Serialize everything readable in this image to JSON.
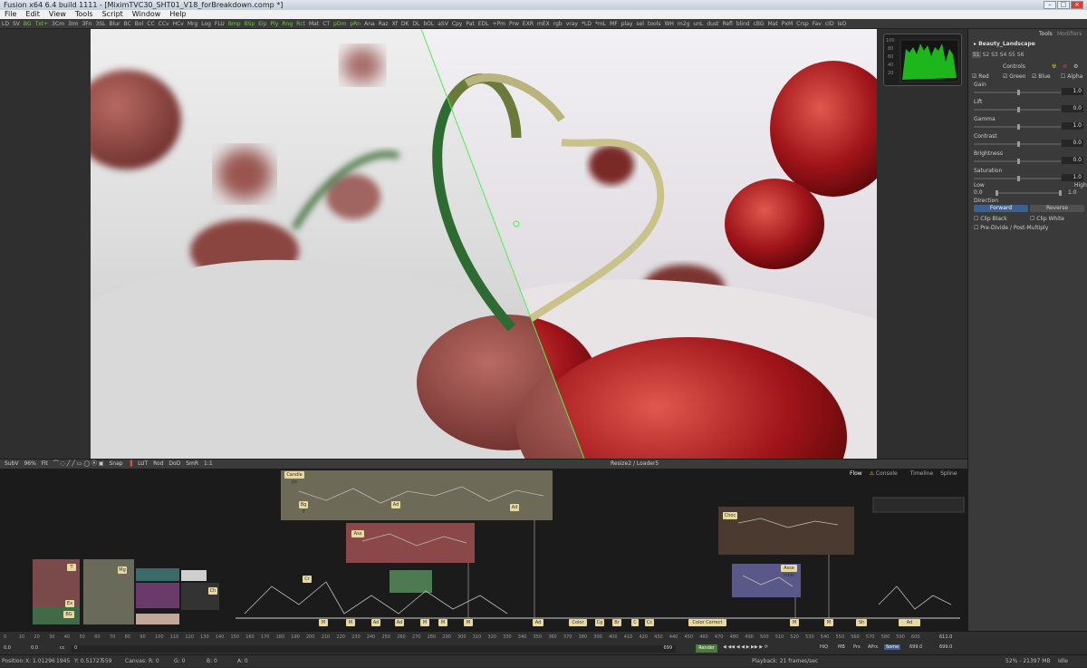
{
  "window": {
    "title": "Fusion x64 6.4 build 1111 - [MiximTVC30_SHT01_V18_forBreakdown.comp *]",
    "controls": [
      "–",
      "□",
      "×"
    ]
  },
  "menu": [
    "File",
    "Edit",
    "View",
    "Tools",
    "Script",
    "Window",
    "Help"
  ],
  "toolbar": [
    "LD",
    "SV",
    "BG",
    "Txt+",
    "3Cm",
    "3Im",
    "3Fn",
    "3SL",
    "Blur",
    "BC",
    "Bol",
    "CC",
    "CCv",
    "HCv",
    "Mrg",
    "Log",
    "FLU",
    "Bmp",
    "BSp",
    "Elp",
    "Ply",
    "Rng",
    "Rct",
    "Mat",
    "CT",
    "pDm",
    "pRn",
    "Ana",
    "Raz",
    "Xf",
    "DK",
    "DL",
    "bOL",
    "aSV",
    "Cpy",
    "Pat",
    "EDL",
    "+Pm",
    "Prw",
    "EXR",
    "mEX",
    "rgb",
    "vray",
    "*LD",
    "*mL",
    "MF",
    "play",
    "sel",
    "tools",
    "WH",
    "m2g",
    "unL",
    "dust",
    "Refl",
    "blind",
    "cBG",
    "Mat",
    "PxM",
    "Crsp",
    "Fav",
    "cID",
    "IsO"
  ],
  "viewer": {
    "buttons": [
      "SubV",
      "96%",
      "Fit",
      "Snap",
      "LUT",
      "Rod",
      "DoD",
      "SmR",
      "1:1"
    ],
    "title": "Resize2 / Loader5",
    "scope_ticks": [
      "100",
      "80",
      "60",
      "40",
      "20"
    ]
  },
  "inspector": {
    "tabs": [
      "Tools",
      "Modifiers"
    ],
    "tool_name": "Beauty_Landscape",
    "channel_tabs": [
      "S1",
      "S2",
      "S3",
      "S4",
      "S5",
      "S6"
    ],
    "section": "Controls",
    "channels": [
      {
        "label": "Red"
      },
      {
        "label": "Green"
      },
      {
        "label": "Blue"
      },
      {
        "label": "Alpha"
      }
    ],
    "params": [
      {
        "label": "Gain",
        "value": "1.0"
      },
      {
        "label": "Lift",
        "value": "0.0"
      },
      {
        "label": "Gamma",
        "value": "1.0"
      },
      {
        "label": "Contrast",
        "value": "0.0"
      },
      {
        "label": "Brightness",
        "value": "0.0"
      },
      {
        "label": "Saturation",
        "value": "1.0"
      }
    ],
    "low_label": "Low",
    "high_label": "High",
    "low_value": "0.0",
    "high_value": "1.0",
    "direction_label": "Direction",
    "forward": "Forward",
    "reverse": "Reverse",
    "clip_black": "Clip Black",
    "clip_white": "Clip White",
    "predivide": "Pre-Divide / Post-Multiply"
  },
  "flow": {
    "tabs": [
      "Flow",
      "Console",
      "Timeline",
      "Spline"
    ],
    "group_labels": [
      "Candle pe",
      "Ass",
      "Choc",
      "Asse mble",
      "T",
      "Ex",
      "BG",
      "Mg",
      "Ch",
      "Ad",
      "Ad",
      "Cr",
      "Bg d"
    ],
    "bottom_nodes": [
      "M",
      "M",
      "Ad",
      "Ad",
      "M",
      "M",
      "M",
      "Ad",
      "Color",
      "Cg",
      "Br",
      "C",
      "Cc",
      "Color Correct",
      "M",
      "M",
      "Sh",
      "Ad"
    ]
  },
  "timeline": {
    "ticks": [
      "0",
      "10",
      "20",
      "30",
      "40",
      "50",
      "60",
      "70",
      "80",
      "90",
      "100",
      "110",
      "120",
      "130",
      "140",
      "150",
      "160",
      "170",
      "180",
      "190",
      "200",
      "210",
      "220",
      "230",
      "240",
      "250",
      "260",
      "270",
      "280",
      "290",
      "300",
      "310",
      "320",
      "330",
      "340",
      "350",
      "360",
      "370",
      "380",
      "390",
      "400",
      "410",
      "420",
      "430",
      "440",
      "450",
      "460",
      "470",
      "480",
      "490",
      "500",
      "510",
      "520",
      "530",
      "540",
      "550",
      "560",
      "570",
      "580",
      "590",
      "600"
    ],
    "start": "0.0",
    "start2": "0.0",
    "cc": "cc",
    "current": "0",
    "end_field": "699",
    "render": "Render",
    "hiq": "HiQ",
    "mb": "MB",
    "prx": "Prx",
    "aprx": "APrx",
    "some": "Some",
    "end_value": "699.0",
    "right_value": "611.0",
    "right_value2": "699.0"
  },
  "status": {
    "position": "Position:",
    "x": "X: 1.01296",
    "xv": "1945",
    "y": "Y: 0.51727",
    "yv": "559",
    "canvas": "Canvas: R: 0",
    "g": "G: 0",
    "b": "B: 0",
    "a": "A: 0",
    "playback": "Playback: 21 frames/sec",
    "mem": "52% - 21397 MB",
    "idle": "Idle"
  },
  "colors": {
    "accent": "#76c44a",
    "node": "#e8d9a0",
    "blue_btn": "#3d5f93"
  }
}
